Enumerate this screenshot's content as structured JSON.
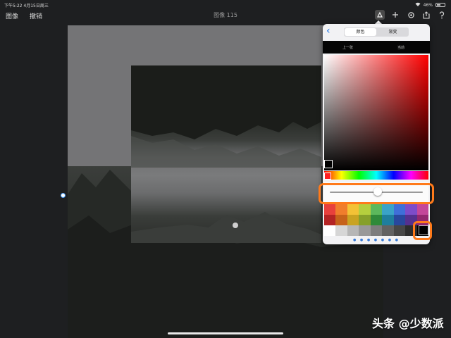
{
  "status": {
    "time": "下午5:22  4月15日周三",
    "battery": "46%",
    "battery_level": 0.46
  },
  "toolbar": {
    "gallery_label": "图像",
    "undo_label": "撤销",
    "title": "图像 115",
    "icons": [
      "brush-icon",
      "plus-icon",
      "settings-icon",
      "share-icon",
      "help-icon"
    ]
  },
  "color_popover": {
    "tabs": [
      "颜色",
      "渐变"
    ],
    "selected_tab": "颜色",
    "previous_label": "上一张",
    "current_label": "当前",
    "opacity_slider_value": 0.52,
    "current_color": "#000000",
    "page_dots": "● ● ● ● ● ● ●",
    "palette": [
      "#e8403c",
      "#f07d2c",
      "#f3c236",
      "#b5cf3e",
      "#5cb85c",
      "#3aa3c8",
      "#3f6fd8",
      "#7d4cc9",
      "#c4479a",
      "#b42424",
      "#c6621a",
      "#c9a322",
      "#86a02b",
      "#2f8a3a",
      "#1f7e9e",
      "#28489e",
      "#55308f",
      "#93286f",
      "#ffffff",
      "#d6d6d6",
      "#b6b6b6",
      "#999999",
      "#7d7d7d",
      "#626262",
      "#474747",
      "#2d2d2d",
      "#000000"
    ]
  },
  "highlight_color": "#ff7a1a",
  "watermark": "头条 @少数派"
}
